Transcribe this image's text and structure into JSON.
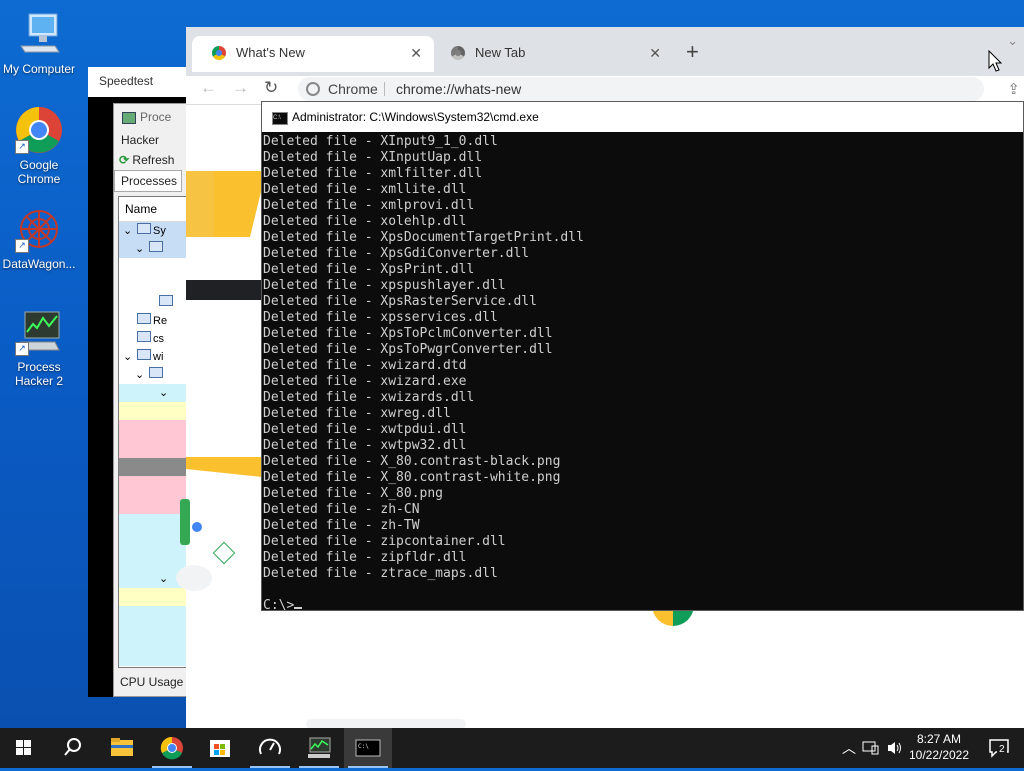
{
  "desktop": {
    "icons": [
      {
        "label": "My Computer",
        "icon": "computer-icon"
      },
      {
        "label": "Google Chrome",
        "icon": "chrome-icon"
      },
      {
        "label": "DataWagon...",
        "icon": "datawagon-icon"
      },
      {
        "label": "Process Hacker 2",
        "icon": "process-hacker-icon"
      }
    ]
  },
  "speedtest": {
    "title": "Speedtest"
  },
  "process_hacker": {
    "title": "Proce",
    "menu": "Hacker",
    "refresh": "Refresh",
    "tab": "Processes",
    "column_name": "Name",
    "rows": [
      "Sy",
      "",
      "",
      "",
      "Re",
      "cs",
      "wi",
      "",
      "",
      "",
      "",
      "",
      "",
      "",
      "",
      ""
    ],
    "status": "CPU Usage"
  },
  "chrome": {
    "tabs": [
      {
        "label": "What's New",
        "active": true
      },
      {
        "label": "New Tab",
        "active": false
      }
    ],
    "new_tab_symbol": "+",
    "site_label": "Chrome",
    "url": "chrome://whats-new"
  },
  "cmd": {
    "title": "Administrator: C:\\Windows\\System32\\cmd.exe",
    "lines": [
      "Deleted file - XInput9_1_0.dll",
      "Deleted file - XInputUap.dll",
      "Deleted file - xmlfilter.dll",
      "Deleted file - xmllite.dll",
      "Deleted file - xmlprovi.dll",
      "Deleted file - xolehlp.dll",
      "Deleted file - XpsDocumentTargetPrint.dll",
      "Deleted file - XpsGdiConverter.dll",
      "Deleted file - XpsPrint.dll",
      "Deleted file - xpspushlayer.dll",
      "Deleted file - XpsRasterService.dll",
      "Deleted file - xpsservices.dll",
      "Deleted file - XpsToPclmConverter.dll",
      "Deleted file - XpsToPwgrConverter.dll",
      "Deleted file - xwizard.dtd",
      "Deleted file - xwizard.exe",
      "Deleted file - xwizards.dll",
      "Deleted file - xwreg.dll",
      "Deleted file - xwtpdui.dll",
      "Deleted file - xwtpw32.dll",
      "Deleted file - X_80.contrast-black.png",
      "Deleted file - X_80.contrast-white.png",
      "Deleted file - X_80.png",
      "Deleted file - zh-CN",
      "Deleted file - zh-TW",
      "Deleted file - zipcontainer.dll",
      "Deleted file - zipfldr.dll",
      "Deleted file - ztrace_maps.dll",
      ""
    ],
    "prompt": "C:\\>"
  },
  "taskbar": {
    "items": [
      "start-icon",
      "search-icon",
      "file-explorer-icon",
      "chrome-icon",
      "store-icon",
      "speedtest-icon",
      "process-hacker-icon",
      "cmd-icon"
    ],
    "time": "8:27 AM",
    "date": "10/22/2022",
    "notification_count": "2"
  }
}
